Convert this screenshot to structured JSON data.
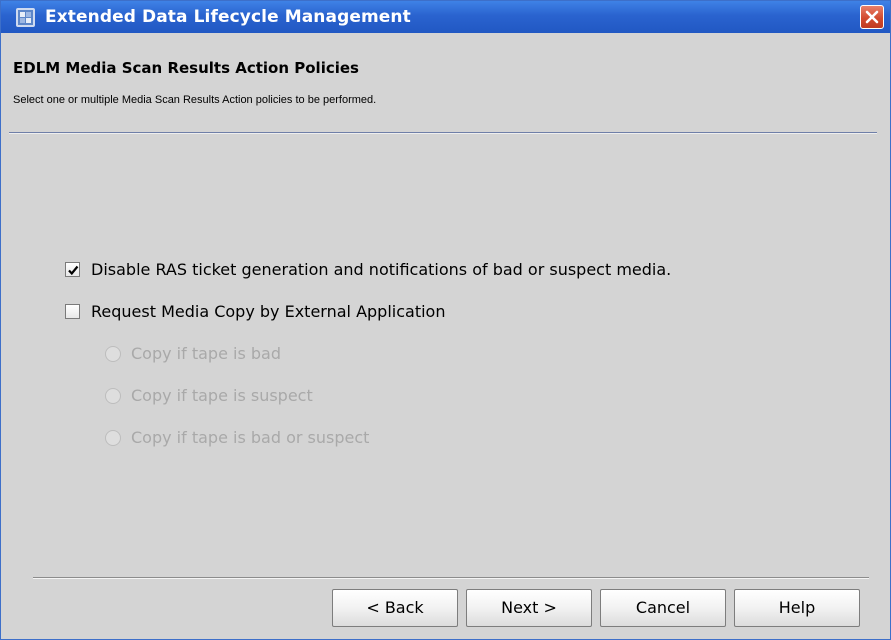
{
  "window": {
    "title": "Extended Data Lifecycle Management",
    "app_icon": "edlm-app-icon",
    "close_icon": "close-icon",
    "titlebar_color": "#2a63cf",
    "close_color": "#d24b2f"
  },
  "header": {
    "title": "EDLM Media Scan Results Action Policies",
    "subtitle": "Select one or multiple Media Scan Results Action policies to be performed."
  },
  "options": {
    "disable_ras": {
      "label": "Disable RAS ticket generation and notifications of bad or suspect media.",
      "checked": true,
      "enabled": true
    },
    "request_copy": {
      "label": "Request Media Copy by External Application",
      "checked": false,
      "enabled": true
    },
    "copy_modes": [
      {
        "label": "Copy if tape is bad",
        "selected": false,
        "enabled": false
      },
      {
        "label": "Copy if tape is suspect",
        "selected": false,
        "enabled": false
      },
      {
        "label": "Copy if tape is bad or suspect",
        "selected": false,
        "enabled": false
      }
    ]
  },
  "buttons": {
    "back": "< Back",
    "next": "Next >",
    "cancel": "Cancel",
    "help": "Help"
  }
}
